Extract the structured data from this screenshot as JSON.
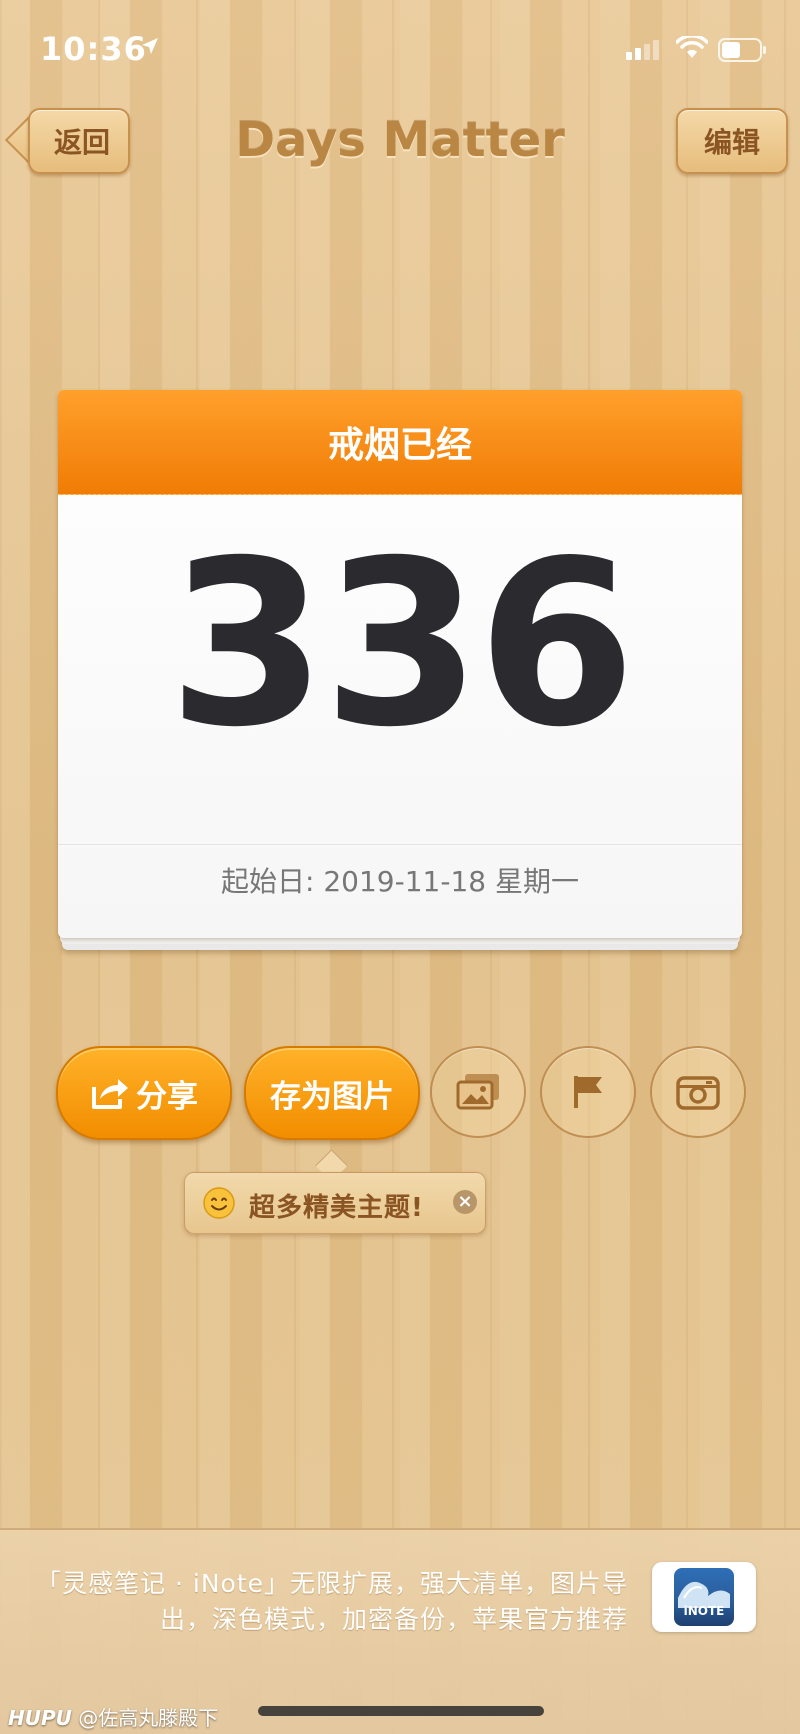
{
  "status_bar": {
    "time": "10:36"
  },
  "nav": {
    "back_label": "返回",
    "title": "Days Matter",
    "edit_label": "编辑"
  },
  "card": {
    "header": "戒烟已经",
    "days": "336",
    "start_date": "起始日: 2019-11-18 星期一",
    "header_color": "#f5870e"
  },
  "actions": {
    "share_label": "分享",
    "save_image_label": "存为图片",
    "icons": [
      "photo-gallery-icon",
      "flag-icon",
      "camera-icon"
    ],
    "accent_color": "#f59a10"
  },
  "tooltip": {
    "text": "超多精美主题!"
  },
  "ad": {
    "line1": "「灵感笔记 · iNote」无限扩展，强大清单，图片导",
    "line2": "出，深色模式，加密备份，苹果官方推荐",
    "icon_label": "iNOTE"
  },
  "watermark": {
    "brand": "HUPU",
    "user": "@佐高丸滕殿下"
  }
}
